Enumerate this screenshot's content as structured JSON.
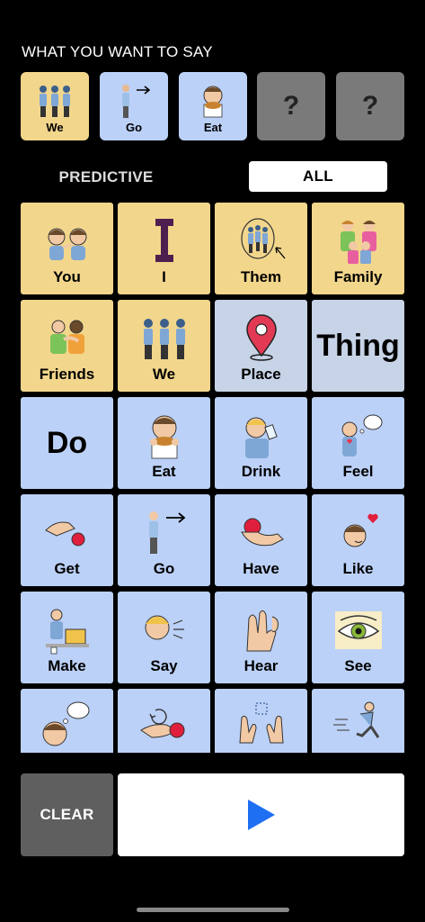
{
  "sentence": {
    "heading": "WHAT YOU WANT TO SAY",
    "tiles": [
      {
        "label": "We",
        "icon": "we-icon",
        "color": "#f2d68c"
      },
      {
        "label": "Go",
        "icon": "go-icon",
        "color": "#bcd1f7"
      },
      {
        "label": "Eat",
        "icon": "eat-icon",
        "color": "#bcd1f7"
      },
      {
        "label": "?",
        "icon": "empty-slot",
        "color": "#7a7a7a"
      },
      {
        "label": "?",
        "icon": "empty-slot",
        "color": "#7a7a7a"
      }
    ]
  },
  "tabs": {
    "predictive": "PREDICTIVE",
    "all": "ALL",
    "selected": "ALL"
  },
  "grid": [
    {
      "label": "You",
      "icon": "you-icon",
      "color": "yellow"
    },
    {
      "label": "I",
      "icon": "i-letter-icon",
      "color": "yellow"
    },
    {
      "label": "Them",
      "icon": "them-icon",
      "color": "yellow"
    },
    {
      "label": "Family",
      "icon": "family-icon",
      "color": "yellow"
    },
    {
      "label": "Friends",
      "icon": "friends-icon",
      "color": "yellow"
    },
    {
      "label": "We",
      "icon": "we-icon",
      "color": "yellow"
    },
    {
      "label": "Place",
      "icon": "location-pin-icon",
      "color": "grayblue"
    },
    {
      "label": "Thing",
      "icon": "text-only",
      "color": "grayblue"
    },
    {
      "label": "Do",
      "icon": "text-only",
      "color": "blue"
    },
    {
      "label": "Eat",
      "icon": "eat-icon",
      "color": "blue"
    },
    {
      "label": "Drink",
      "icon": "drink-icon",
      "color": "blue"
    },
    {
      "label": "Feel",
      "icon": "feel-icon",
      "color": "blue"
    },
    {
      "label": "Get",
      "icon": "get-icon",
      "color": "blue"
    },
    {
      "label": "Go",
      "icon": "go-icon",
      "color": "blue"
    },
    {
      "label": "Have",
      "icon": "have-icon",
      "color": "blue"
    },
    {
      "label": "Like",
      "icon": "like-icon",
      "color": "blue"
    },
    {
      "label": "Make",
      "icon": "make-icon",
      "color": "blue"
    },
    {
      "label": "Say",
      "icon": "say-icon",
      "color": "blue"
    },
    {
      "label": "Hear",
      "icon": "hear-icon",
      "color": "blue"
    },
    {
      "label": "See",
      "icon": "eye-icon",
      "color": "blue"
    },
    {
      "label": "",
      "icon": "think-icon",
      "color": "blue"
    },
    {
      "label": "",
      "icon": "give-icon",
      "color": "blue"
    },
    {
      "label": "",
      "icon": "hands-icon",
      "color": "blue"
    },
    {
      "label": "",
      "icon": "run-icon",
      "color": "blue"
    }
  ],
  "actions": {
    "clear": "CLEAR",
    "speak_icon": "play-icon",
    "play_color": "#1f6ff2"
  }
}
